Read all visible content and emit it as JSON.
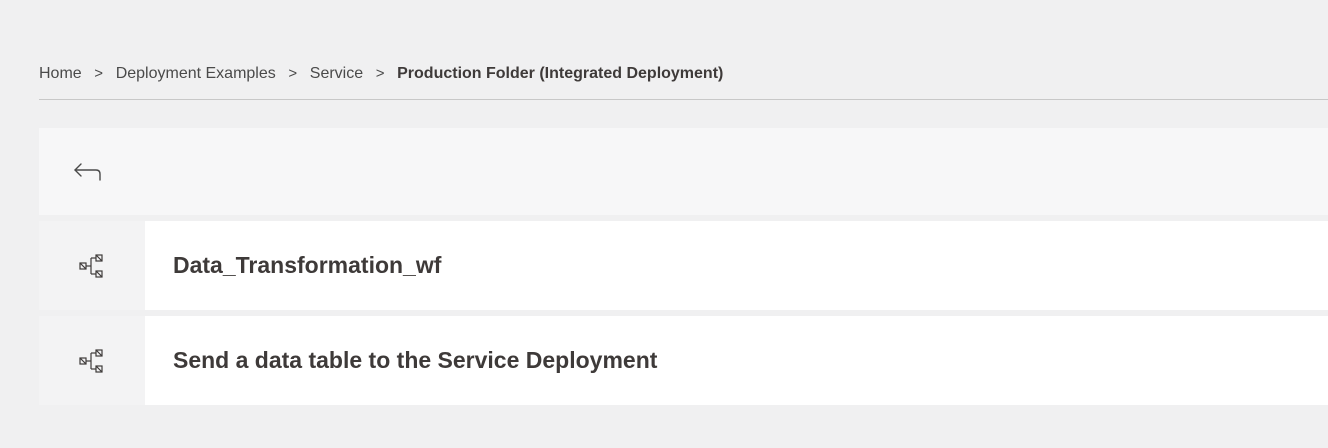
{
  "breadcrumb": {
    "items": [
      {
        "label": "Home"
      },
      {
        "label": "Deployment Examples"
      },
      {
        "label": "Service"
      },
      {
        "label": "Production Folder (Integrated Deployment)"
      }
    ],
    "separator": ">"
  },
  "back": {
    "icon": "back-arrow-icon"
  },
  "items": [
    {
      "icon": "workflow-icon",
      "name": "Data_Transformation_wf"
    },
    {
      "icon": "workflow-icon",
      "name": "Send a data table to the Service Deployment"
    }
  ],
  "colors": {
    "background": "#f0f0f1",
    "row": "#ffffff",
    "icon_cell": "#f3f3f4",
    "text": "#3e3a39"
  }
}
